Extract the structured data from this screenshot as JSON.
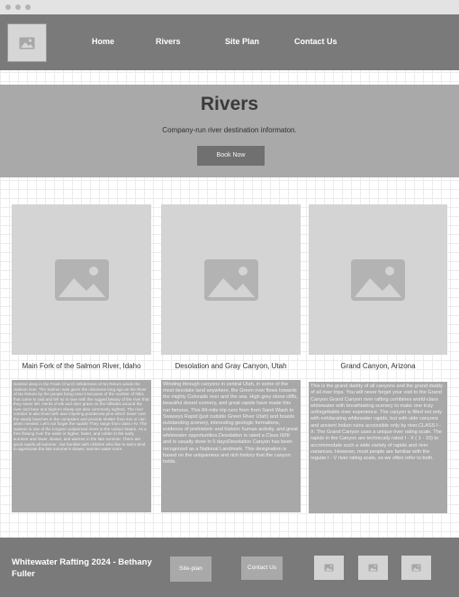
{
  "nav": {
    "links": [
      "Home",
      "Rivers",
      "Site Plan",
      "Contact Us"
    ]
  },
  "hero": {
    "title": "Rivers",
    "subtitle": "Company-run river destination informaton.",
    "button": "Book Now"
  },
  "cards": [
    {
      "title": "Main Fork of the Salmon River, Idaho",
      "description": "Nestled deep in the Frank Church Wilderness of No Return winds the Salmon river. The Salmon was given the nickname long ago as the River of No Return by the people living near it because of the number of folks that came to raid and fell so in love with the rugged beauty of the river that they never left. Herds of elk and deer graze on the hillsides around the river and bear and bighorn sheep are also commonly sighted. The river corridor is also lined with awe inspiring ponderosa pine which tower over the sandy beaches in the campsites and provide shelter from sun or rain when needed. Let's not forget the rapids! They range from class I-IV. The Salmon is one of the longest undammed rivers in the United States. As a free flowing river the water is higher, faster, and colder in the early summer and lower, slower, and warmer in the late summer. There are good rapids all summer...but families with children who like to swim tend to appreciate the late summer's slower, warmer water more."
    },
    {
      "title": "Desolation and Gray Canyon, Utah",
      "description": "Winding through canyons in central Utah, in some of the most desolate land anywhere, the Green river flows towards the mighty Colorado river and the sea. High grey stone cliffs, beautiful desert scenery, and great rapids have made this run famous. This 84-mile trip runs from from Sand Wash to Swaseys Rapid (just outside Green River Utah) and boasts outstanding scenery, interesting geologic formations, evidence of prehistoric and historic human activity, and great whitewater opportunities.Desolation is rated a Class III/III and is usually done in 5 daysDesolation Canyon has been recognized as a National Landmark. This designation is based on the uniqueness and rich history that the canyon holds."
    },
    {
      "title": "Grand Canyon, Arizona",
      "description": "This is the grand daddy of all canyons and the grand daddy of all river trips. You will never forget your visit to the Grand Canyon.Grand Canyon river rafting combines world-class whitewater with breathtaking scenery to make one truly unforgettable river experience. The canyon is filled not only with exhilarating whitewater rapids, but with side canyons and ancient Indian ruins accessible only by river.CLASS I - X: The Grand Canyon uses a unique river rating scale. The rapids in the Canyon are technically rated I - X ( 1 - 10) to accommodate such a wide variety of rapids and river variances. However, most people are familiar with the regular I - V river rating scale, so we often refer to both."
    }
  ],
  "footer": {
    "title": "Whitewater Rafting 2024 - Bethany Fuller",
    "buttons": [
      "Site-plan",
      "Contact Us"
    ]
  },
  "colors": {
    "navbar": "#7a7a7a",
    "hero": "#a9a9a9",
    "placeholder": "#d4d4d4",
    "footer": "#7a7a7a"
  }
}
